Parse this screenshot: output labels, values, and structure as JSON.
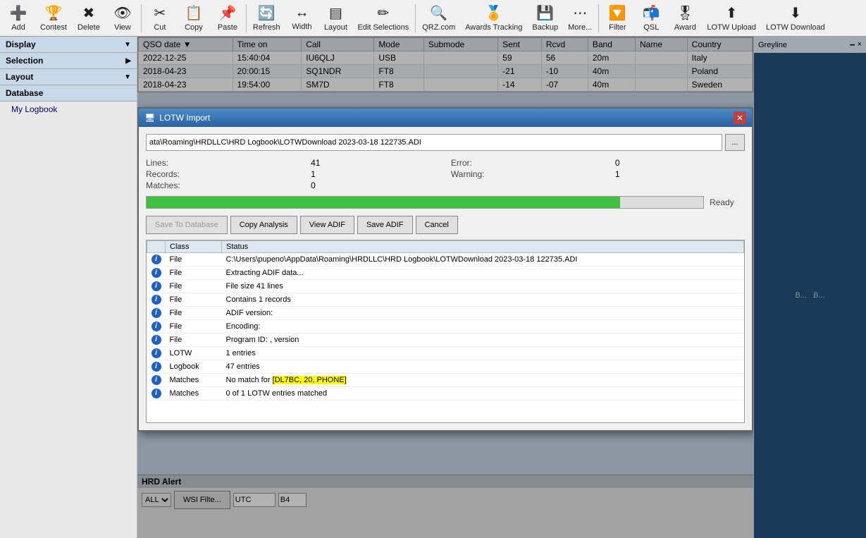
{
  "toolbar": {
    "buttons": [
      {
        "id": "add",
        "label": "Add",
        "icon": "➕"
      },
      {
        "id": "contest",
        "label": "Contest",
        "icon": "🏆"
      },
      {
        "id": "delete",
        "label": "Delete",
        "icon": "✖"
      },
      {
        "id": "view",
        "label": "View",
        "icon": "👁"
      },
      {
        "id": "cut",
        "label": "Cut",
        "icon": "✂"
      },
      {
        "id": "copy",
        "label": "Copy",
        "icon": "📋"
      },
      {
        "id": "paste",
        "label": "Paste",
        "icon": "📌"
      },
      {
        "id": "refresh",
        "label": "Refresh",
        "icon": "🔄"
      },
      {
        "id": "width",
        "label": "Width",
        "icon": "↔"
      },
      {
        "id": "layout",
        "label": "Layout",
        "icon": "▤"
      },
      {
        "id": "edit-selections",
        "label": "Edit Selections",
        "icon": "✏"
      },
      {
        "id": "qrz",
        "label": "QRZ.com",
        "icon": "🔍"
      },
      {
        "id": "awards-tracking",
        "label": "Awards Tracking",
        "icon": "🏅"
      },
      {
        "id": "backup",
        "label": "Backup",
        "icon": "💾"
      },
      {
        "id": "more",
        "label": "More...",
        "icon": "▼"
      },
      {
        "id": "filter",
        "label": "Filter",
        "icon": "🔽"
      },
      {
        "id": "qsl",
        "label": "QSL",
        "icon": "📬"
      },
      {
        "id": "award",
        "label": "Award",
        "icon": "🎖"
      },
      {
        "id": "lotw-upload",
        "label": "LOTW Upload",
        "icon": "⬆"
      },
      {
        "id": "lotw-download",
        "label": "LOTW Download",
        "icon": "⬇"
      }
    ]
  },
  "sidebar": {
    "display_label": "Display",
    "selection_label": "Selection",
    "layout_label": "Layout",
    "database_label": "Database",
    "my_logbook_label": "My Logbook"
  },
  "qso_table": {
    "columns": [
      "QSO date",
      "Time on",
      "Call",
      "Mode",
      "Submode",
      "Sent",
      "Rcvd",
      "Band",
      "Name",
      "Country"
    ],
    "rows": [
      {
        "date": "2022-12-25",
        "time": "15:40:04",
        "call": "IU6QLJ",
        "mode": "USB",
        "submode": "",
        "sent": "59",
        "rcvd": "56",
        "band": "20m",
        "name": "",
        "country": "Italy"
      },
      {
        "date": "2018-04-23",
        "time": "20:00:15",
        "call": "SQ1NDR",
        "mode": "FT8",
        "submode": "",
        "sent": "-21",
        "rcvd": "-10",
        "band": "40m",
        "name": "",
        "country": "Poland"
      },
      {
        "date": "2018-04-23",
        "time": "19:54:00",
        "call": "SM7D",
        "mode": "FT8",
        "submode": "",
        "sent": "-14",
        "rcvd": "-07",
        "band": "40m",
        "name": "",
        "country": "Sweden"
      }
    ]
  },
  "modal": {
    "title": "LOTW Import",
    "file_path": "ata\\Roaming\\HRDLLC\\HRD Logbook\\LOTWDownload 2023-03-18 122735.ADI",
    "browse_label": "...",
    "stats": {
      "lines_label": "Lines:",
      "lines_value": "41",
      "records_label": "Records:",
      "records_value": "1",
      "matches_label": "Matches:",
      "matches_value": "0",
      "error_label": "Error:",
      "error_value": "0",
      "warning_label": "Warning:",
      "warning_value": "1"
    },
    "progress_label": "Ready",
    "progress_percent": 85,
    "buttons": {
      "save_to_database": "Save To Database",
      "copy_analysis": "Copy Analysis",
      "view_adif": "View ADIF",
      "save_adif": "Save ADIF",
      "cancel": "Cancel"
    },
    "log_columns": [
      "",
      "Class",
      "Status"
    ],
    "log_rows": [
      {
        "icon": "i",
        "class": "File",
        "status": "C:\\Users\\pupeno\\AppData\\Roaming\\HRDLLC\\HRD Logbook\\LOTWDownload 2023-03-18 122735.ADI",
        "highlight": false
      },
      {
        "icon": "i",
        "class": "File",
        "status": "Extracting ADIF data...",
        "highlight": false
      },
      {
        "icon": "i",
        "class": "File",
        "status": "File size 41 lines",
        "highlight": false
      },
      {
        "icon": "i",
        "class": "File",
        "status": "Contains 1 records",
        "highlight": false
      },
      {
        "icon": "i",
        "class": "File",
        "status": "ADIF version:",
        "highlight": false
      },
      {
        "icon": "i",
        "class": "File",
        "status": "Encoding:",
        "highlight": false
      },
      {
        "icon": "i",
        "class": "File",
        "status": "Program ID:  , version",
        "highlight": false
      },
      {
        "icon": "i",
        "class": "LOTW",
        "status": "1 entries",
        "highlight": false
      },
      {
        "icon": "i",
        "class": "Logbook",
        "status": "47 entries",
        "highlight": false
      },
      {
        "icon": "i",
        "class": "Matches",
        "status_pre": "No match for ",
        "highlight_text": "[DL7BC, 20, PHONE]",
        "status_post": "",
        "highlight": true
      },
      {
        "icon": "i",
        "class": "Matches",
        "status": "0 of 1 LOTW entries matched",
        "highlight": false
      }
    ]
  },
  "hrd_alert": {
    "title": "HRD Alert",
    "all_option": "ALL",
    "wsi_filter_label": "WSI Filte...",
    "utc_label": "UTC",
    "b4_label": "B4"
  },
  "right_panel": {
    "title": "Greyline",
    "close_label": "×",
    "pin_label": "🗕",
    "map_labels": [
      "B...",
      "B..."
    ]
  }
}
